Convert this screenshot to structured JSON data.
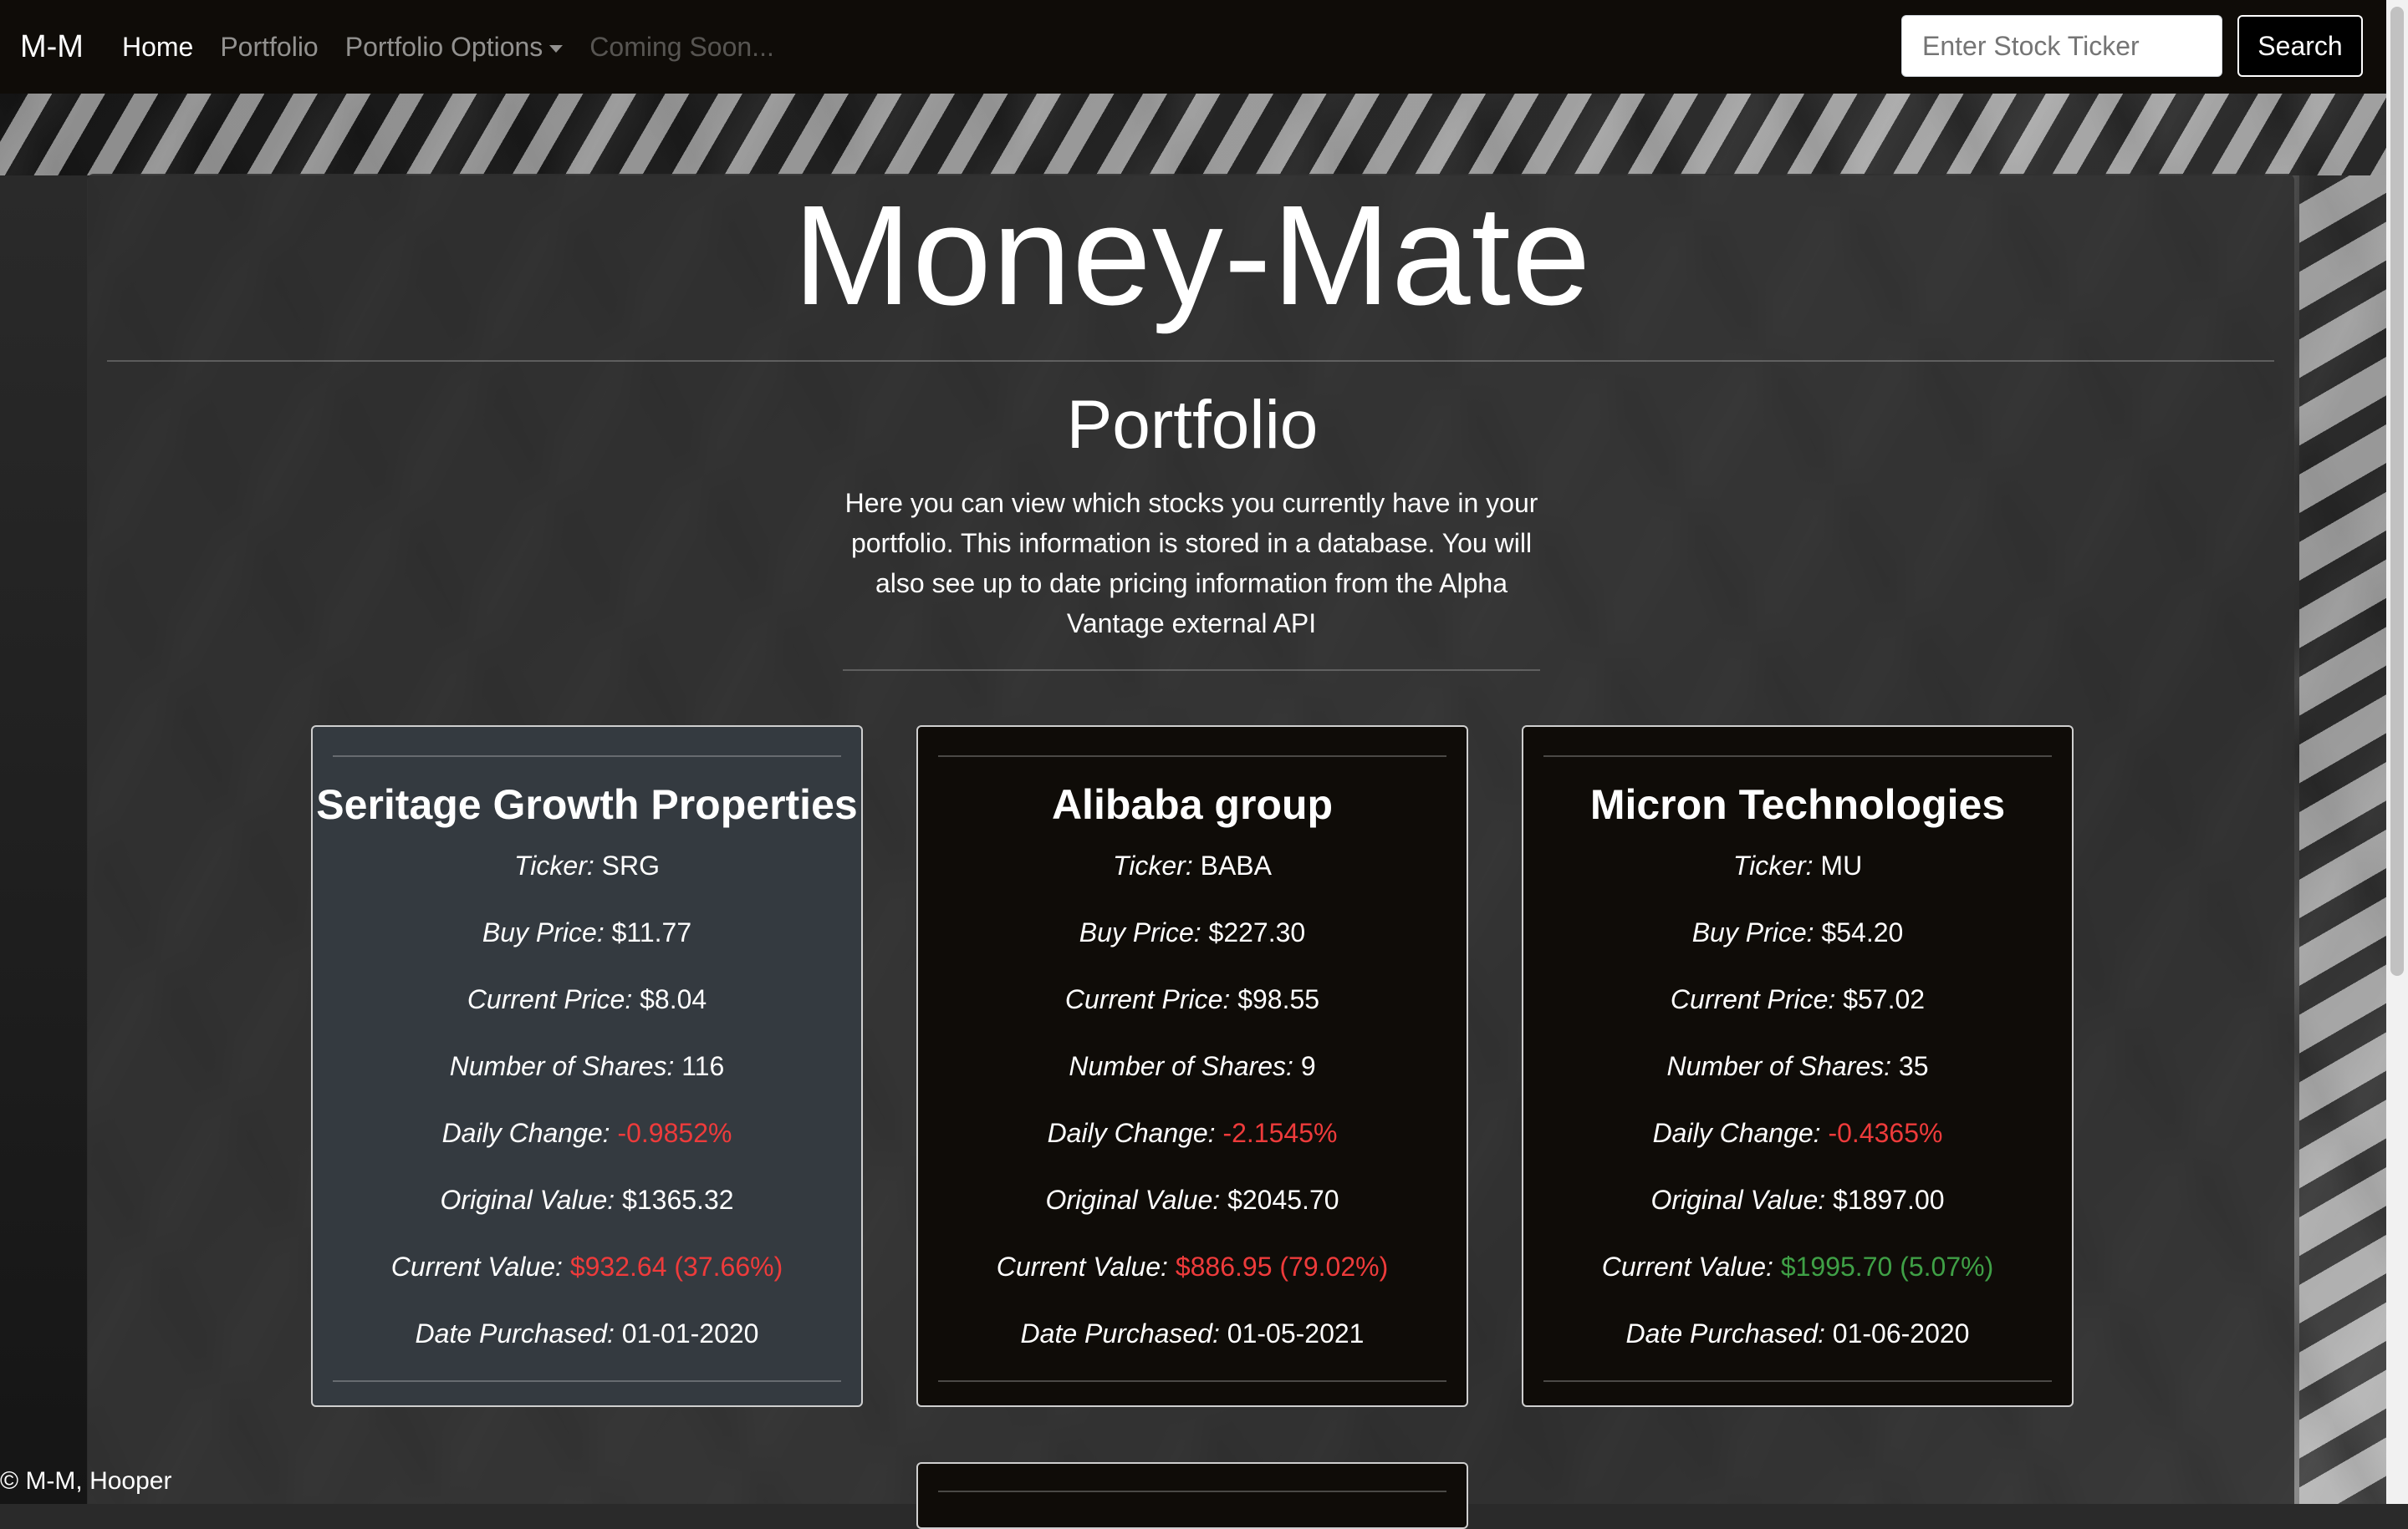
{
  "navbar": {
    "brand": "M-M",
    "links": [
      "Home",
      "Portfolio",
      "Portfolio Options",
      "Coming Soon..."
    ],
    "search_placeholder": "Enter Stock Ticker",
    "search_button": "Search"
  },
  "main": {
    "title": "Money-Mate",
    "subtitle": "Portfolio",
    "description": "Here you can view which stocks you currently have in your portfolio. This information is stored in a database. You will also see up to date pricing information from the Alpha Vantage external API"
  },
  "labels": {
    "ticker": "Ticker:",
    "buy_price": "Buy Price:",
    "current_price": "Current Price:",
    "shares": "Number of Shares:",
    "daily_change": "Daily Change:",
    "original_value": "Original Value:",
    "current_value": "Current Value:",
    "date_purchased": "Date Purchased:"
  },
  "cards": [
    {
      "name": "Seritage Growth Properties",
      "ticker": "SRG",
      "buy_price": "$11.77",
      "current_price": "$8.04",
      "shares": "116",
      "daily_change": "-0.9852%",
      "original_value": "$1365.32",
      "current_value": "$932.64 (37.66%)",
      "date_purchased": "01-01-2020"
    },
    {
      "name": "Alibaba group",
      "ticker": "BABA",
      "buy_price": "$227.30",
      "current_price": "$98.55",
      "shares": "9",
      "daily_change": "-2.1545%",
      "original_value": "$2045.70",
      "current_value": "$886.95 (79.02%)",
      "date_purchased": "01-05-2021"
    },
    {
      "name": "Micron Technologies",
      "ticker": "MU",
      "buy_price": "$54.20",
      "current_price": "$57.02",
      "shares": "35",
      "daily_change": "-0.4365%",
      "original_value": "$1897.00",
      "current_value": "$1995.70 (5.07%)",
      "date_purchased": "01-06-2020"
    }
  ],
  "colors": {
    "negative": "#ee3b3b",
    "positive": "#3fa046",
    "navbar_bg": "#0f0c08"
  },
  "footer": "© M-M, Hooper"
}
